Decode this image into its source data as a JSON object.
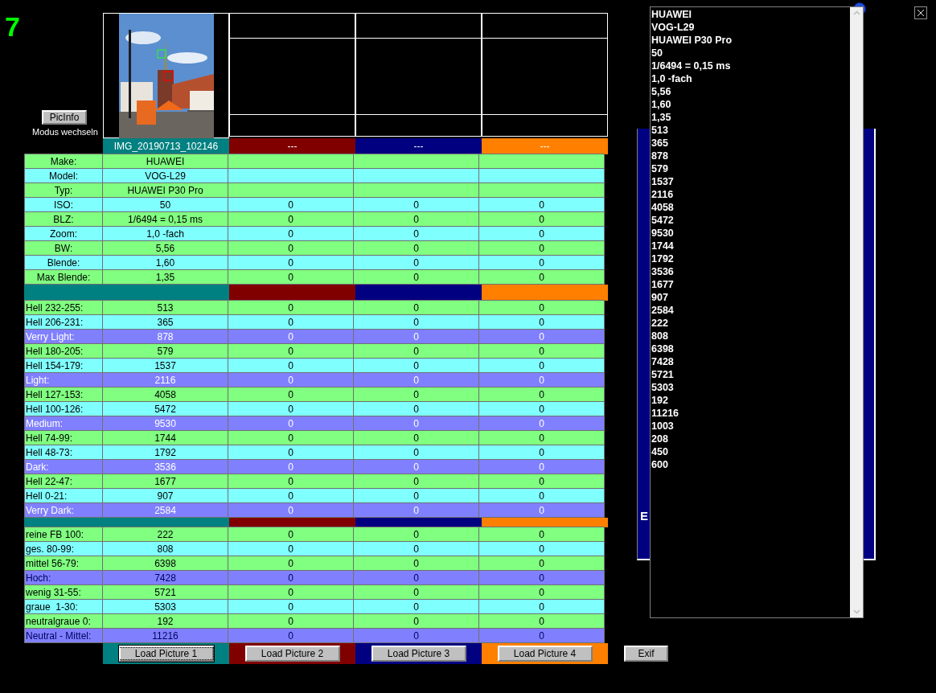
{
  "logo": {
    "text": "7"
  },
  "picinfo_button": "PicInfo",
  "mode_label": "Modus wechseln",
  "columns": [
    {
      "header": "IMG_20190713_102146",
      "color": "#008080"
    },
    {
      "header": "---",
      "color": "#800000"
    },
    {
      "header": "---",
      "color": "#000080"
    },
    {
      "header": "---",
      "color": "#ff8000"
    }
  ],
  "sections": [
    {
      "kind": "exif",
      "rows": [
        {
          "label": "Make:",
          "color": "#80ff80",
          "values": [
            "HUAWEI"
          ]
        },
        {
          "label": "Model:",
          "color": "#80ffff",
          "values": [
            "VOG-L29"
          ]
        },
        {
          "label": "Typ:",
          "color": "#80ff80",
          "values": [
            "HUAWEI P30 Pro"
          ]
        },
        {
          "label": "ISO:",
          "color": "#80ffff",
          "values": [
            "50",
            "0",
            "0",
            "0"
          ]
        },
        {
          "label": "BLZ:",
          "color": "#80ff80",
          "values": [
            "1/6494 = 0,15 ms",
            "0",
            "0",
            "0"
          ]
        },
        {
          "label": "Zoom:",
          "color": "#80ffff",
          "values": [
            "1,0 -fach",
            "0",
            "0",
            "0"
          ]
        },
        {
          "label": "BW:",
          "color": "#80ff80",
          "values": [
            "5,56",
            "0",
            "0",
            "0"
          ]
        },
        {
          "label": "Blende:",
          "color": "#80ffff",
          "values": [
            "1,60",
            "0",
            "0",
            "0"
          ]
        },
        {
          "label": "Max Blende:",
          "color": "#80ff80",
          "values": [
            "1,35",
            "0",
            "0",
            "0"
          ]
        }
      ]
    },
    {
      "kind": "brightness",
      "rows": [
        {
          "label": "Hell 232-255:",
          "color": "#80ff80",
          "values": [
            "513",
            "0",
            "0",
            "0"
          ]
        },
        {
          "label": "Hell 206-231:",
          "color": "#80ffff",
          "values": [
            "365",
            "0",
            "0",
            "0"
          ]
        },
        {
          "label": "Verry Light:",
          "color": "#8080ff",
          "values": [
            "878",
            "0",
            "0",
            "0"
          ]
        },
        {
          "label": "Hell 180-205:",
          "color": "#80ff80",
          "values": [
            "579",
            "0",
            "0",
            "0"
          ]
        },
        {
          "label": "Hell 154-179:",
          "color": "#80ffff",
          "values": [
            "1537",
            "0",
            "0",
            "0"
          ]
        },
        {
          "label": "Light:",
          "color": "#8080ff",
          "values": [
            "2116",
            "0",
            "0",
            "0"
          ]
        },
        {
          "label": "Hell 127-153:",
          "color": "#80ff80",
          "values": [
            "4058",
            "0",
            "0",
            "0"
          ]
        },
        {
          "label": "Hell 100-126:",
          "color": "#80ffff",
          "values": [
            "5472",
            "0",
            "0",
            "0"
          ]
        },
        {
          "label": "Medium:",
          "color": "#8080ff",
          "values": [
            "9530",
            "0",
            "0",
            "0"
          ]
        },
        {
          "label": "Hell 74-99:",
          "color": "#80ff80",
          "values": [
            "1744",
            "0",
            "0",
            "0"
          ]
        },
        {
          "label": "Hell 48-73:",
          "color": "#80ffff",
          "values": [
            "1792",
            "0",
            "0",
            "0"
          ]
        },
        {
          "label": "Dark:",
          "color": "#8080ff",
          "values": [
            "3536",
            "0",
            "0",
            "0"
          ]
        },
        {
          "label": "Hell 22-47:",
          "color": "#80ff80",
          "values": [
            "1677",
            "0",
            "0",
            "0"
          ]
        },
        {
          "label": "Hell 0-21:",
          "color": "#80ffff",
          "values": [
            "907",
            "0",
            "0",
            "0"
          ]
        },
        {
          "label": "Verry Dark:",
          "color": "#8080ff",
          "values": [
            "2584",
            "0",
            "0",
            "0"
          ]
        }
      ]
    },
    {
      "kind": "saturation",
      "rows": [
        {
          "label": "reine FB 100:",
          "color": "#80ff80",
          "values": [
            "222",
            "0",
            "0",
            "0"
          ]
        },
        {
          "label": "ges. 80-99:",
          "color": "#80ffff",
          "values": [
            "808",
            "0",
            "0",
            "0"
          ]
        },
        {
          "label": "mittel 56-79:",
          "color": "#80ff80",
          "values": [
            "6398",
            "0",
            "0",
            "0"
          ]
        },
        {
          "label": "Hoch:",
          "color": "#8080ff",
          "values": [
            "7428",
            "0",
            "0",
            "0"
          ]
        },
        {
          "label": "wenig 31-55:",
          "color": "#80ff80",
          "values": [
            "5721",
            "0",
            "0",
            "0"
          ]
        },
        {
          "label": "graue  1-30:",
          "color": "#80ffff",
          "values": [
            "5303",
            "0",
            "0",
            "0"
          ]
        },
        {
          "label": "neutralgraue 0:",
          "color": "#80ff80",
          "values": [
            "192",
            "0",
            "0",
            "0"
          ]
        },
        {
          "label": "Neutral - Mittel:",
          "color": "#8080ff",
          "values": [
            "11216",
            "0",
            "0",
            "0"
          ]
        }
      ]
    }
  ],
  "load_buttons": [
    {
      "label": "Load Picture 1",
      "focused": true
    },
    {
      "label": "Load Picture 2",
      "focused": false
    },
    {
      "label": "Load Picture 3",
      "focused": false
    },
    {
      "label": "Load Picture 4",
      "focused": false
    }
  ],
  "exif_button": "Exif",
  "background_panel": {
    "text": "E"
  },
  "exif_list": [
    "HUAWEI",
    "VOG-L29",
    "HUAWEI P30 Pro",
    "50",
    "1/6494 = 0,15 ms",
    "1,0 -fach",
    "5,56",
    "1,60",
    "1,35",
    "513",
    "365",
    "878",
    "579",
    "1537",
    "2116",
    "4058",
    "5472",
    "9530",
    "1744",
    "1792",
    "3536",
    "1677",
    "907",
    "2584",
    "222",
    "808",
    "6398",
    "7428",
    "5721",
    "5303",
    "192",
    "11216",
    "1003",
    "208",
    "450",
    "600"
  ]
}
